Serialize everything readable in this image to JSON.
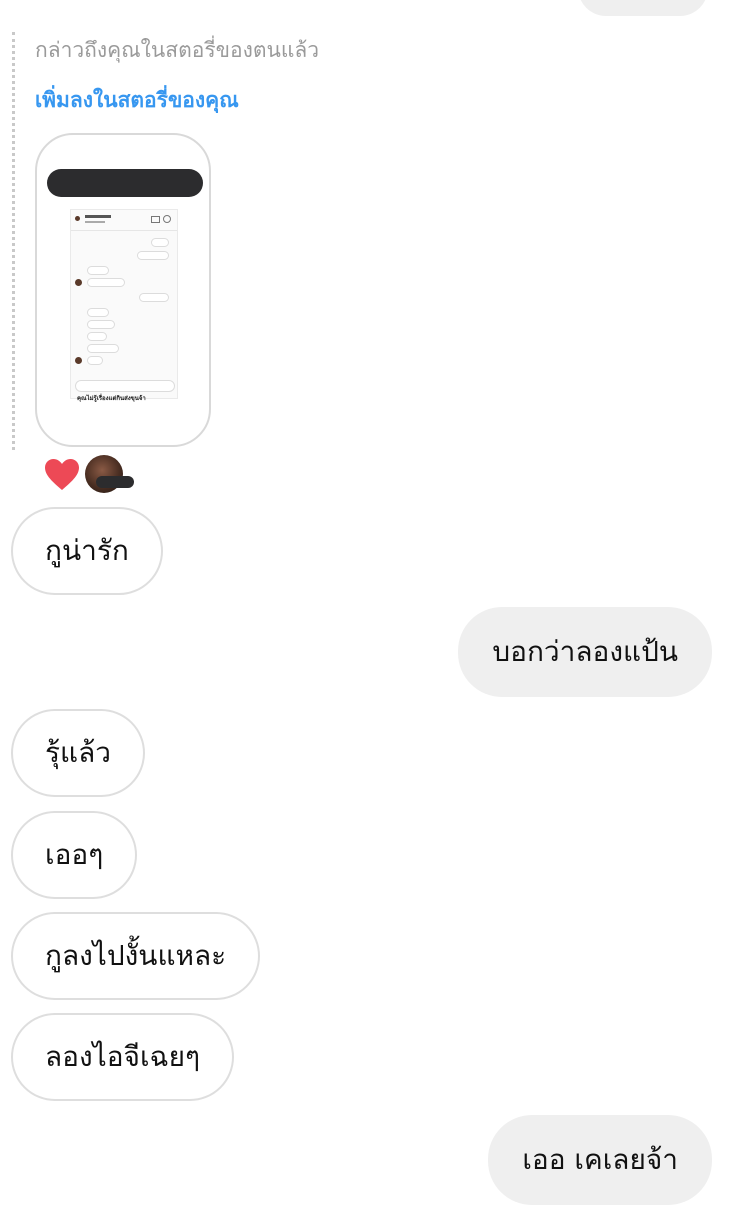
{
  "story_mention": {
    "mention_text": "กล่าวถึงคุณในสตอรี่ของตนแล้ว",
    "add_to_story_label": "เพิ่มลงในสตอรี่ของคุณ",
    "story_caption": "คุณไม่รู้เรื่องแต่กินส่งขุนจ้า"
  },
  "reactions": {
    "emoji": "heart-icon",
    "heart_color": "#ed4956"
  },
  "messages": [
    {
      "direction": "received",
      "text": "กูน่ารัก"
    },
    {
      "direction": "sent",
      "text": "บอกว่าลองแป้น"
    },
    {
      "direction": "received",
      "text": "รุ้แล้ว"
    },
    {
      "direction": "received",
      "text": "เออๆ"
    },
    {
      "direction": "received",
      "text": "กูลงไปงั้นแหละ"
    },
    {
      "direction": "received",
      "text": "ลองไอจีเฉยๆ"
    },
    {
      "direction": "sent",
      "text": "เออ เคเลยจ้า"
    }
  ],
  "colors": {
    "link": "#3797f0",
    "sent_bubble": "#efefef",
    "received_border": "#dedede"
  }
}
